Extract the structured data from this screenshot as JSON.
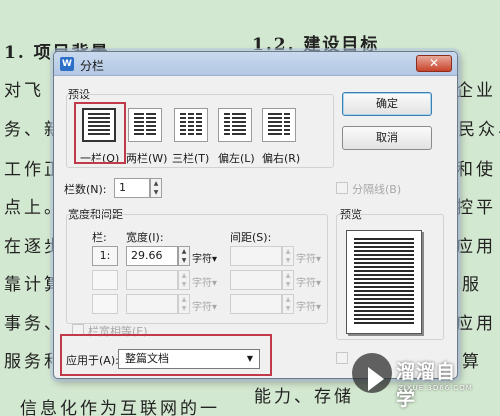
{
  "document": {
    "lines_left": [
      "对飞",
      "务、新",
      "工作正",
      "点上。",
      "在逐步",
      "靠计算",
      "事务、",
      "服务和"
    ],
    "heading_left": "1.  项目背景",
    "heading_right": "1.2.  建设目标",
    "lines_right": [
      "企业",
      "民众、",
      "和使",
      "控平",
      "应用",
      "服",
      "应用",
      "算"
    ],
    "bottom_left": "信息化作为互联网的一",
    "bottom_right": "能力、存储"
  },
  "dialog": {
    "title": "分栏",
    "title_icon": "W",
    "close_symbol": "✕",
    "preset_group_label": "预设",
    "presets": [
      {
        "label": "一栏(O)",
        "columns": 1,
        "selected": true
      },
      {
        "label": "两栏(W)",
        "columns": 2,
        "selected": false
      },
      {
        "label": "三栏(T)",
        "columns": 3,
        "selected": false
      },
      {
        "label": "偏左(L)",
        "columns": 2,
        "selected": false
      },
      {
        "label": "偏右(R)",
        "columns": 2,
        "selected": false
      }
    ],
    "ok_label": "确定",
    "cancel_label": "取消",
    "columns_count_label": "栏数(N):",
    "columns_count_value": "1",
    "separator_label": "分隔线(B)",
    "width_spacing_group_label": "宽度和间距",
    "col_header": "栏:",
    "width_header": "宽度(I):",
    "spacing_header": "间距(S):",
    "rows": [
      {
        "num": "1:",
        "width": "29.66",
        "width_unit": "字符▾",
        "spacing": "",
        "spacing_unit": "字符▾"
      },
      {
        "num": "",
        "width": "",
        "width_unit": "字符▾",
        "spacing": "",
        "spacing_unit": "字符▾"
      },
      {
        "num": "",
        "width": "",
        "width_unit": "字符▾",
        "spacing": "",
        "spacing_unit": "字符▾"
      }
    ],
    "equal_width_label": "栏宽相等(E)",
    "preview_label": "预览",
    "apply_to_label": "应用于(A):",
    "apply_to_value": "整篇文档"
  },
  "watermark": {
    "title": "溜溜自学",
    "subtitle": "ZIXUE.3D66.COM"
  },
  "colors": {
    "highlight": "#c03a4a",
    "background": "#d3e8d0"
  }
}
